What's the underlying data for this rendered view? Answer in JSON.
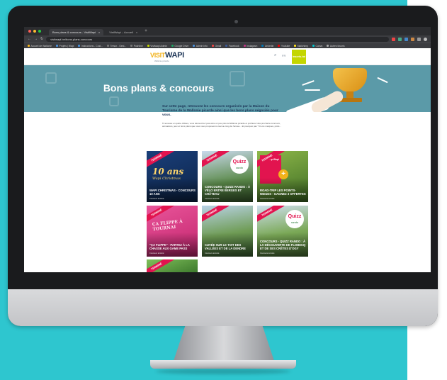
{
  "browser": {
    "tabs": [
      {
        "label": "Bons plans & concours - VisitWapi",
        "active": true
      },
      {
        "label": "VisitWapi – Accueil",
        "active": false
      }
    ],
    "new_tab": "+",
    "url": "visitwapi.be/bons-plans-concours",
    "bookmarks": [
      "Accueil de Wallonie",
      "Projets | Wapi",
      "Instructions - Cost...",
      "Trésor - Gest...",
      "Pushline",
      "Visitwapi Admin",
      "Google Drive",
      "Admin Info",
      "Gmail",
      "Facebook",
      "Instagram",
      "Linkedin",
      "Youtube",
      "Mailchimp",
      "Canva",
      "Autres favoris"
    ],
    "colors": {
      "close": "#ff5f57",
      "min": "#febc2e",
      "max": "#28c840"
    }
  },
  "site": {
    "logo": {
      "part1": "VISIT",
      "part2": "WAPI",
      "tagline": "Wallonie picarde"
    },
    "lang": "FR",
    "cta_label": "Inscris-toi",
    "colors": {
      "hero": "#5b9aa8",
      "accent": "#c4d600",
      "ribbon": "#e2144f",
      "brand_blue": "#1d3557"
    },
    "hero_title": "Bons plans & concours",
    "intro_lead": "Sur cette page, retrouvez les concours organisés par la Maison du Tourisme de la Wallonie picarde ainsi que les bons plans négociés pour vous.",
    "intro_body": "À nouveau en quête d'idées, vous découvrirez peut-être un peu plus la Wallonie picarde et profiterez des prochains concours, animations, jeux et bons plans que nous vous proposerons tout au long de l'année... Et pourquoi pas ? À vos marques, prêts...",
    "ribbon_label": "TERMINÉ",
    "cards": [
      {
        "title": "Wapi Christmas - Concours 10 ans",
        "meta": "Concours terminé",
        "big": "10 ans",
        "sub": "Wapi Christmas",
        "bg": "linear-gradient(160deg,#1a3f7a,#0c2347)"
      },
      {
        "title": "Concours - Quizz Rando : À vélo entre berges et château",
        "meta": "Concours terminé",
        "quizz_top": "Quizz",
        "quizz_bottom": "rando",
        "bg": "linear-gradient(170deg,#c9d9ec,#5b8a4a 60%,#3b5f2e)"
      },
      {
        "title": "Road-Trip Les points-Nœuds - Gagnez 3 offertes",
        "meta": "Concours terminé",
        "brochure": "Road-Trip Wapi",
        "bg": "linear-gradient(160deg,#8fb84a,#3f6e25)"
      },
      {
        "title": "\"Ça flippe\" - Partez à la chasse aux game pass",
        "meta": "Concours terminé",
        "pink": "ÇA FLIPPE À TOURNAI",
        "bg": "linear-gradient(160deg,#e9559a,#c2246d)"
      },
      {
        "title": "Cuvée sur le toit des Vallées et de la Dendre",
        "meta": "Concours terminé",
        "bg": "linear-gradient(170deg,#b9d3e6,#6f9c55 55%,#3a6130)"
      },
      {
        "title": "Concours - Quizz Rando : À la découverte de Flobecq et de ses crêtes d'Ogy",
        "meta": "Concours terminé",
        "quizz_top": "Quizz",
        "quizz_bottom": "rando",
        "bg": "linear-gradient(170deg,#cfe0ee,#7aa856 55%,#486f33)"
      }
    ]
  }
}
